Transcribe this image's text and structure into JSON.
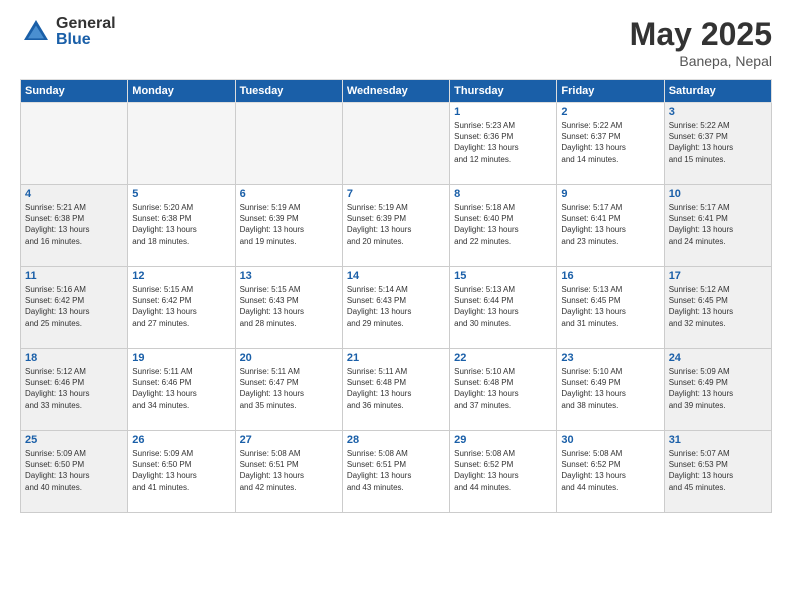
{
  "header": {
    "logo_general": "General",
    "logo_blue": "Blue",
    "month_title": "May 2025",
    "location": "Banepa, Nepal"
  },
  "days_of_week": [
    "Sunday",
    "Monday",
    "Tuesday",
    "Wednesday",
    "Thursday",
    "Friday",
    "Saturday"
  ],
  "weeks": [
    [
      {
        "day": "",
        "empty": true
      },
      {
        "day": "",
        "empty": true
      },
      {
        "day": "",
        "empty": true
      },
      {
        "day": "",
        "empty": true
      },
      {
        "day": "1",
        "lines": [
          "Sunrise: 5:23 AM",
          "Sunset: 6:36 PM",
          "Daylight: 13 hours",
          "and 12 minutes."
        ]
      },
      {
        "day": "2",
        "lines": [
          "Sunrise: 5:22 AM",
          "Sunset: 6:37 PM",
          "Daylight: 13 hours",
          "and 14 minutes."
        ]
      },
      {
        "day": "3",
        "shaded": true,
        "lines": [
          "Sunrise: 5:22 AM",
          "Sunset: 6:37 PM",
          "Daylight: 13 hours",
          "and 15 minutes."
        ]
      }
    ],
    [
      {
        "day": "4",
        "shaded": true,
        "lines": [
          "Sunrise: 5:21 AM",
          "Sunset: 6:38 PM",
          "Daylight: 13 hours",
          "and 16 minutes."
        ]
      },
      {
        "day": "5",
        "lines": [
          "Sunrise: 5:20 AM",
          "Sunset: 6:38 PM",
          "Daylight: 13 hours",
          "and 18 minutes."
        ]
      },
      {
        "day": "6",
        "lines": [
          "Sunrise: 5:19 AM",
          "Sunset: 6:39 PM",
          "Daylight: 13 hours",
          "and 19 minutes."
        ]
      },
      {
        "day": "7",
        "lines": [
          "Sunrise: 5:19 AM",
          "Sunset: 6:39 PM",
          "Daylight: 13 hours",
          "and 20 minutes."
        ]
      },
      {
        "day": "8",
        "lines": [
          "Sunrise: 5:18 AM",
          "Sunset: 6:40 PM",
          "Daylight: 13 hours",
          "and 22 minutes."
        ]
      },
      {
        "day": "9",
        "lines": [
          "Sunrise: 5:17 AM",
          "Sunset: 6:41 PM",
          "Daylight: 13 hours",
          "and 23 minutes."
        ]
      },
      {
        "day": "10",
        "shaded": true,
        "lines": [
          "Sunrise: 5:17 AM",
          "Sunset: 6:41 PM",
          "Daylight: 13 hours",
          "and 24 minutes."
        ]
      }
    ],
    [
      {
        "day": "11",
        "shaded": true,
        "lines": [
          "Sunrise: 5:16 AM",
          "Sunset: 6:42 PM",
          "Daylight: 13 hours",
          "and 25 minutes."
        ]
      },
      {
        "day": "12",
        "lines": [
          "Sunrise: 5:15 AM",
          "Sunset: 6:42 PM",
          "Daylight: 13 hours",
          "and 27 minutes."
        ]
      },
      {
        "day": "13",
        "lines": [
          "Sunrise: 5:15 AM",
          "Sunset: 6:43 PM",
          "Daylight: 13 hours",
          "and 28 minutes."
        ]
      },
      {
        "day": "14",
        "lines": [
          "Sunrise: 5:14 AM",
          "Sunset: 6:43 PM",
          "Daylight: 13 hours",
          "and 29 minutes."
        ]
      },
      {
        "day": "15",
        "lines": [
          "Sunrise: 5:13 AM",
          "Sunset: 6:44 PM",
          "Daylight: 13 hours",
          "and 30 minutes."
        ]
      },
      {
        "day": "16",
        "lines": [
          "Sunrise: 5:13 AM",
          "Sunset: 6:45 PM",
          "Daylight: 13 hours",
          "and 31 minutes."
        ]
      },
      {
        "day": "17",
        "shaded": true,
        "lines": [
          "Sunrise: 5:12 AM",
          "Sunset: 6:45 PM",
          "Daylight: 13 hours",
          "and 32 minutes."
        ]
      }
    ],
    [
      {
        "day": "18",
        "shaded": true,
        "lines": [
          "Sunrise: 5:12 AM",
          "Sunset: 6:46 PM",
          "Daylight: 13 hours",
          "and 33 minutes."
        ]
      },
      {
        "day": "19",
        "lines": [
          "Sunrise: 5:11 AM",
          "Sunset: 6:46 PM",
          "Daylight: 13 hours",
          "and 34 minutes."
        ]
      },
      {
        "day": "20",
        "lines": [
          "Sunrise: 5:11 AM",
          "Sunset: 6:47 PM",
          "Daylight: 13 hours",
          "and 35 minutes."
        ]
      },
      {
        "day": "21",
        "lines": [
          "Sunrise: 5:11 AM",
          "Sunset: 6:48 PM",
          "Daylight: 13 hours",
          "and 36 minutes."
        ]
      },
      {
        "day": "22",
        "lines": [
          "Sunrise: 5:10 AM",
          "Sunset: 6:48 PM",
          "Daylight: 13 hours",
          "and 37 minutes."
        ]
      },
      {
        "day": "23",
        "lines": [
          "Sunrise: 5:10 AM",
          "Sunset: 6:49 PM",
          "Daylight: 13 hours",
          "and 38 minutes."
        ]
      },
      {
        "day": "24",
        "shaded": true,
        "lines": [
          "Sunrise: 5:09 AM",
          "Sunset: 6:49 PM",
          "Daylight: 13 hours",
          "and 39 minutes."
        ]
      }
    ],
    [
      {
        "day": "25",
        "shaded": true,
        "lines": [
          "Sunrise: 5:09 AM",
          "Sunset: 6:50 PM",
          "Daylight: 13 hours",
          "and 40 minutes."
        ]
      },
      {
        "day": "26",
        "lines": [
          "Sunrise: 5:09 AM",
          "Sunset: 6:50 PM",
          "Daylight: 13 hours",
          "and 41 minutes."
        ]
      },
      {
        "day": "27",
        "lines": [
          "Sunrise: 5:08 AM",
          "Sunset: 6:51 PM",
          "Daylight: 13 hours",
          "and 42 minutes."
        ]
      },
      {
        "day": "28",
        "lines": [
          "Sunrise: 5:08 AM",
          "Sunset: 6:51 PM",
          "Daylight: 13 hours",
          "and 43 minutes."
        ]
      },
      {
        "day": "29",
        "lines": [
          "Sunrise: 5:08 AM",
          "Sunset: 6:52 PM",
          "Daylight: 13 hours",
          "and 44 minutes."
        ]
      },
      {
        "day": "30",
        "lines": [
          "Sunrise: 5:08 AM",
          "Sunset: 6:52 PM",
          "Daylight: 13 hours",
          "and 44 minutes."
        ]
      },
      {
        "day": "31",
        "shaded": true,
        "lines": [
          "Sunrise: 5:07 AM",
          "Sunset: 6:53 PM",
          "Daylight: 13 hours",
          "and 45 minutes."
        ]
      }
    ]
  ]
}
